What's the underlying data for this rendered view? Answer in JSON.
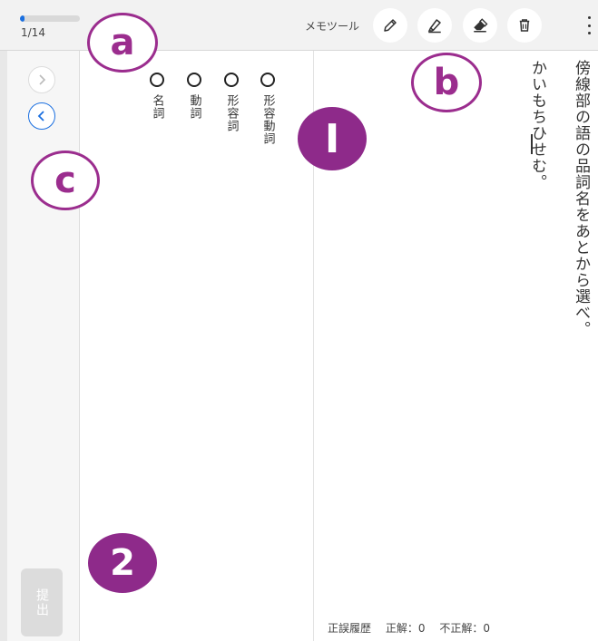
{
  "progress": {
    "counter": "1/14",
    "fraction": 0.07
  },
  "toolbar": {
    "memo_label": "メモツール",
    "tools": [
      {
        "name": "pencil-icon"
      },
      {
        "name": "highlighter-icon"
      },
      {
        "name": "eraser-icon"
      },
      {
        "name": "trash-icon"
      }
    ],
    "more": "more-vertical-icon"
  },
  "nav": {
    "next_icon": "chevron-right-icon",
    "prev_icon": "chevron-left-icon",
    "submit_label": "提出"
  },
  "options": [
    {
      "label": "名詞"
    },
    {
      "label": "動詞"
    },
    {
      "label": "形容詞"
    },
    {
      "label": "形容動詞"
    }
  ],
  "question": {
    "instruction": "傍線部の語の品詞名をあとから選べ。",
    "sentence": "かいもちひせむ。"
  },
  "history": {
    "title": "正誤履歴",
    "correct": "正解：0",
    "incorrect": "不正解：0"
  },
  "annotations": {
    "a": "a",
    "b": "b",
    "c": "c",
    "one": "I",
    "two": "2"
  },
  "colors": {
    "accent": "#1a6fe0",
    "annotation": "#9b2d8e",
    "submit_disabled": "#dcdcdc"
  }
}
